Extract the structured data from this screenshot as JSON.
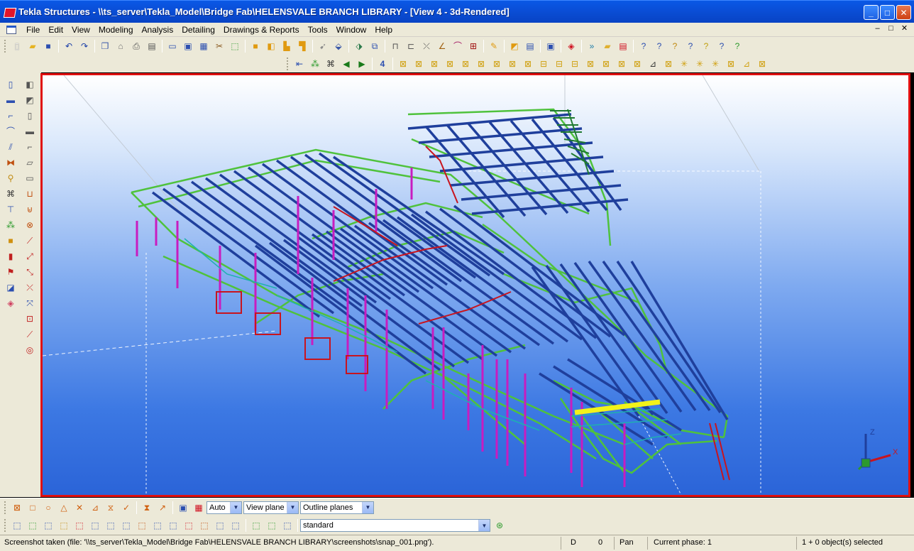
{
  "window": {
    "title": "Tekla Structures - \\\\ts_server\\Tekla_Model\\Bridge Fab\\HELENSVALE BRANCH LIBRARY - [View 4 - 3d-Rendered]",
    "buttons": {
      "minimize": "_",
      "maximize": "□",
      "close": "✕"
    }
  },
  "menu": {
    "items": [
      "File",
      "Edit",
      "View",
      "Modeling",
      "Analysis",
      "Detailing",
      "Drawings & Reports",
      "Tools",
      "Window",
      "Help"
    ],
    "doc_controls": [
      "–",
      "□",
      "✕"
    ]
  },
  "bottom_toolbar": {
    "auto_select": "Auto",
    "view_plane_select": "View plane",
    "outline_planes_select": "Outline planes",
    "standard_select": "standard"
  },
  "status": {
    "message": "Screenshot taken (file: '\\\\ts_server\\Tekla_Model\\Bridge Fab\\HELENSVALE BRANCH LIBRARY\\screenshots\\snap_001.png').",
    "mode_d": "D",
    "value_zero": "0",
    "pan": "Pan",
    "phase": "Current phase: 1",
    "selected": "1 + 0 object(s) selected"
  },
  "axis_labels": {
    "z": "Z",
    "x": "X"
  },
  "colors": {
    "selection_border": "#e01010",
    "beam_blue": "#1f3f9c",
    "truss_green": "#4fc23c",
    "column_magenta": "#c81cc0",
    "rafter_red": "#c8141e",
    "highlight_yellow": "#f2f21a"
  }
}
